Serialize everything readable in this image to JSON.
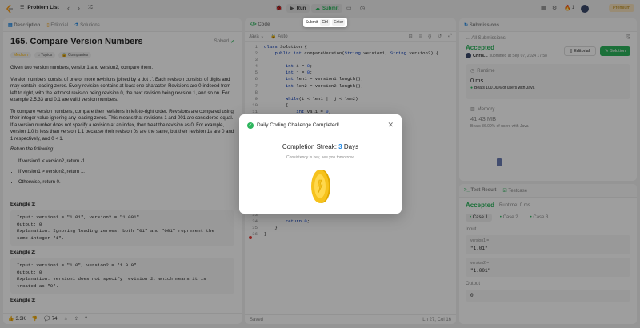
{
  "topbar": {
    "problem_list": "Problem List",
    "run": "Run",
    "submit": "Submit",
    "streak_count": "1",
    "premium": "Premium"
  },
  "tooltip": {
    "label": "Submit",
    "key1": "Ctrl",
    "key2": "Enter"
  },
  "left": {
    "tabs": [
      "Description",
      "Editorial",
      "Solutions"
    ],
    "title": "165. Compare Version Numbers",
    "solved": "Solved",
    "difficulty": "Medium",
    "tags_label": "Topics",
    "companies_label": "Companies",
    "p1": "Given two version numbers, version1 and version2, compare them.",
    "p2": "Version numbers consist of one or more revisions joined by a dot '.'. Each revision consists of digits and may contain leading zeros. Every revision contains at least one character. Revisions are 0-indexed from left to right, with the leftmost revision being revision 0, the next revision being revision 1, and so on. For example 2.5.33 and 0.1 are valid version numbers.",
    "p3": "To compare version numbers, compare their revisions in left-to-right order. Revisions are compared using their integer value ignoring any leading zeros. This means that revisions 1 and 001 are considered equal. If a version number does not specify a revision at an index, then treat the revision as 0. For example, version 1.0 is less than version 1.1 because their revision 0s are the same, but their revision 1s are 0 and 1 respectively, and 0 < 1.",
    "return_label": "Return the following:",
    "bullets": [
      "If version1 < version2, return -1.",
      "If version1 > version2, return 1.",
      "Otherwise, return 0."
    ],
    "ex1_title": "Example 1:",
    "ex1": "Input: version1 = \"1.01\", version2 = \"1.001\"\nOutput: 0\nExplanation: Ignoring leading zeroes, both \"01\" and \"001\" represent the\nsame integer \"1\".",
    "ex2_title": "Example 2:",
    "ex2": "Input: version1 = \"1.0\", version2 = \"1.0.0\"\nOutput: 0\nExplanation: version1 does not specify revision 2, which means it is\ntreated as \"0\".",
    "ex3_title": "Example 3:",
    "likes": "3.3K",
    "comments": "74"
  },
  "code": {
    "tab": "Code",
    "lang": "Java",
    "auto": "Auto",
    "lines_top": [
      "class Solution {",
      "    public int compareVersion(String version1, String version2) {",
      "",
      "        int i = 0;",
      "        int j = 0;",
      "        int len1 = version1.length();",
      "        int len2 = version2.length();",
      "",
      "        while(i < len1 || j < len2)",
      "        {",
      "            int val1 = 0;",
      "            int val2 = 0;"
    ],
    "lines_bottom": [
      "",
      "        return 0;",
      "    }",
      "}"
    ],
    "bottom_nums": [
      "33",
      "34",
      "35",
      "36"
    ],
    "status": "Saved",
    "cursor": "Ln 27, Col 16"
  },
  "submissions": {
    "tab": "Submissions",
    "all": "All Submissions",
    "status": "Accepted",
    "user": "Chris...",
    "date": "submitted at Sep 07, 2024 17:58",
    "editorial": "Editorial",
    "solution": "Solution",
    "runtime_label": "Runtime",
    "runtime": "0 ms",
    "beats_runtime": "Beats 100.00% of users with Java",
    "memory_label": "Memory",
    "memory": "41.43 MB",
    "beats_memory": "Beats 36.00% of users with Java"
  },
  "testresult": {
    "tab": "Test Result",
    "tab2": "Testcase",
    "status": "Accepted",
    "runtime": "Runtime: 0 ms",
    "cases": [
      "Case 1",
      "Case 2",
      "Case 3"
    ],
    "input_label": "Input",
    "v1_label": "version1 =",
    "v1": "\"1.01\"",
    "v2_label": "version2 =",
    "v2": "\"1.001\"",
    "output_label": "Output",
    "output": "0"
  },
  "modal": {
    "title": "Daily Coding Challenge Completed!",
    "streak_prefix": "Completion Streak: ",
    "streak_num": "3",
    "streak_suffix": " Days",
    "sub": "Consistency is key, see you tomorrow!",
    "accent": "#2db55d",
    "coin": "#f6c21c"
  }
}
